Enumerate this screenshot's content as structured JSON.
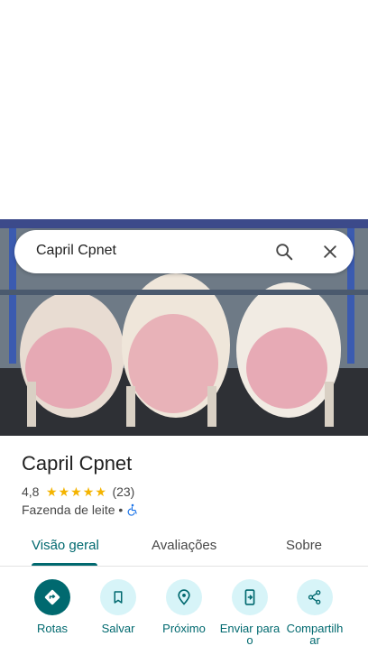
{
  "search": {
    "query": "Capril Cpnet"
  },
  "place": {
    "title": "Capril Cpnet",
    "rating": "4,8",
    "stars": [
      "★",
      "★",
      "★",
      "★",
      "★"
    ],
    "review_count": "(23)",
    "category": "Fazenda de leite •"
  },
  "tabs": [
    {
      "label": "Visão geral"
    },
    {
      "label": "Avaliações"
    },
    {
      "label": "Sobre"
    }
  ],
  "actions": [
    {
      "label": "Rotas",
      "icon": "directions-icon"
    },
    {
      "label": "Salvar",
      "icon": "bookmark-icon"
    },
    {
      "label": "Próximo",
      "icon": "nearby-icon"
    },
    {
      "label": "Enviar para o",
      "icon": "send-to-phone-icon"
    },
    {
      "label": "Compartilhar",
      "icon": "share-icon"
    }
  ],
  "colors": {
    "accent": "#00696f",
    "action_bg": "#d7f4f8",
    "star": "#f4b400"
  }
}
